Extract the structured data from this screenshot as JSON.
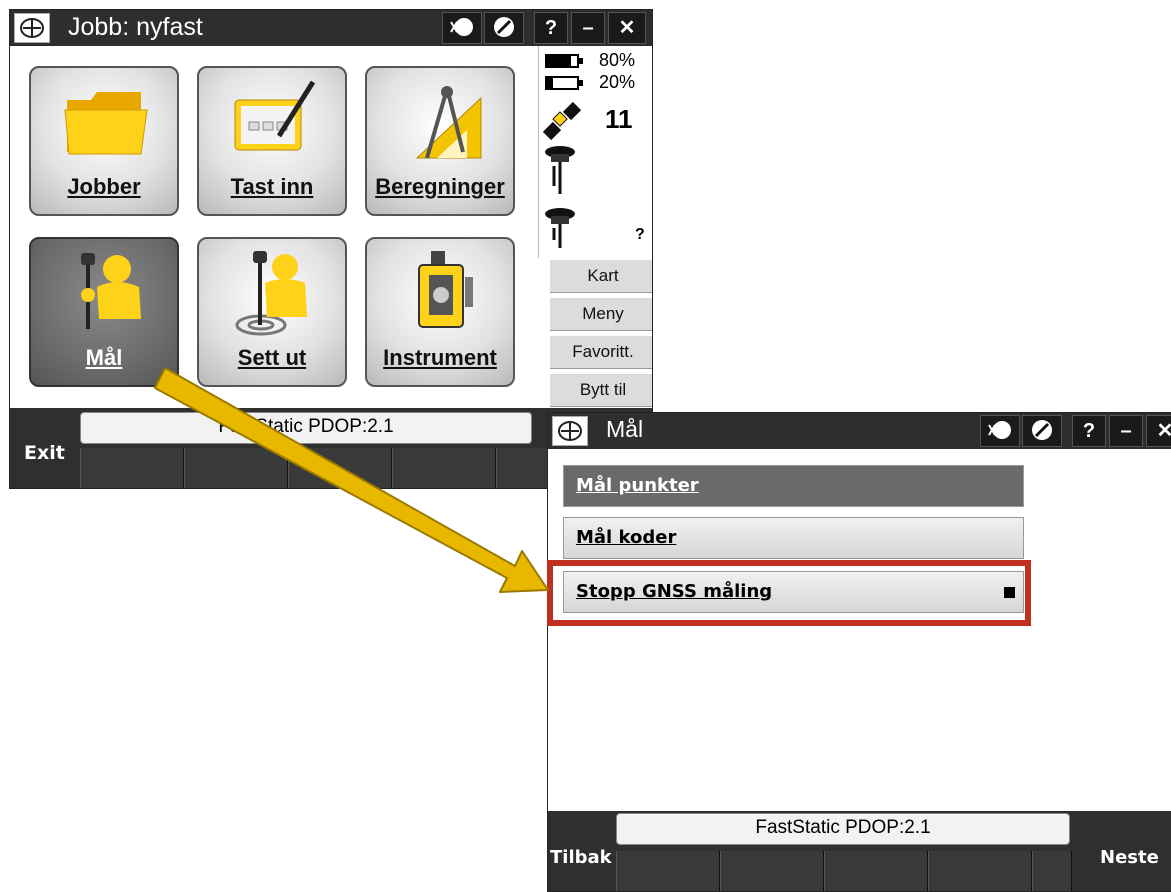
{
  "window1": {
    "title": "Jobb: nyfast",
    "help_label": "?",
    "minimize_label": "–",
    "close_label": "✕",
    "tiles": [
      {
        "label": "Jobber",
        "icon": "folder-icon"
      },
      {
        "label": "Tast inn",
        "icon": "keyboard-pen-icon"
      },
      {
        "label": "Beregninger",
        "icon": "compass-ruler-icon"
      },
      {
        "label": "Mål",
        "icon": "surveyor-measure-icon"
      },
      {
        "label": "Sett ut",
        "icon": "surveyor-stakeout-icon"
      },
      {
        "label": "Instrument",
        "icon": "total-station-icon"
      }
    ],
    "status": {
      "battery1": "80%",
      "battery1_level": 0.8,
      "battery2": "20%",
      "battery2_level": 0.2,
      "satellites": "11",
      "rover_status": "?"
    },
    "side_buttons": [
      "Kart",
      "Meny",
      "Favoritt.",
      "Bytt til"
    ],
    "status_text": "FastStatic PDOP:2.1",
    "exit_label": "Exit"
  },
  "window2": {
    "title": "Mål",
    "help_label": "?",
    "minimize_label": "–",
    "close_label": "✕",
    "menu_items": [
      {
        "label": "Mål punkter"
      },
      {
        "label": "Mål koder"
      },
      {
        "label": "Stopp GNSS måling"
      }
    ],
    "status_text": "FastStatic PDOP:2.1",
    "back_label": "Tilbak",
    "next_label": "Neste"
  },
  "colors": {
    "titlebar": "#2e2e2e",
    "highlight_box": "#c0301f",
    "arrow": "#e8b800",
    "accent_yellow": "#f5c400"
  }
}
